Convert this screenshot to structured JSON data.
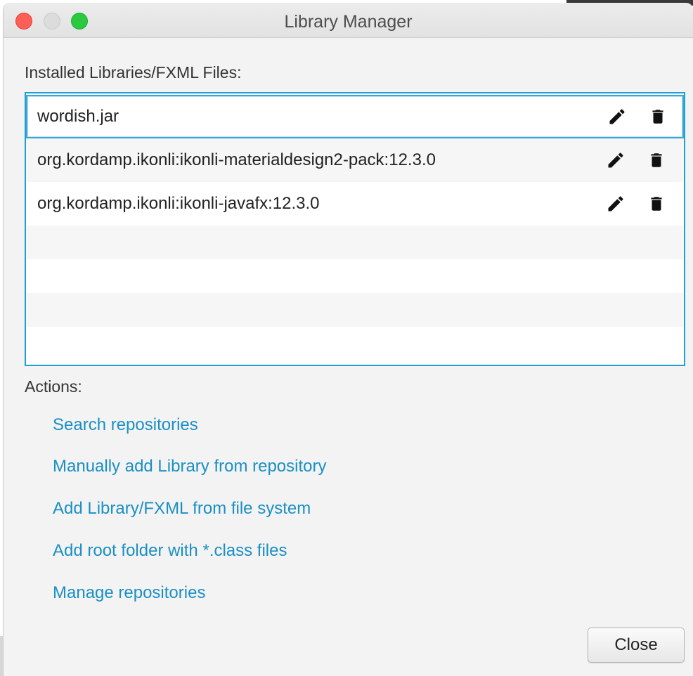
{
  "window": {
    "title": "Library Manager"
  },
  "installed": {
    "label": "Installed Libraries/FXML Files:",
    "items": [
      {
        "name": "wordish.jar",
        "selected": true,
        "edit_icon": "pencil-icon",
        "delete_icon": "trash-icon"
      },
      {
        "name": "org.kordamp.ikonli:ikonli-materialdesign2-pack:12.3.0",
        "selected": false,
        "edit_icon": "pencil-icon",
        "delete_icon": "trash-icon"
      },
      {
        "name": "org.kordamp.ikonli:ikonli-javafx:12.3.0",
        "selected": false,
        "edit_icon": "pencil-icon",
        "delete_icon": "trash-icon"
      }
    ]
  },
  "actions": {
    "label": "Actions:",
    "links": [
      "Search repositories",
      "Manually add Library from repository",
      "Add Library/FXML from file system",
      "Add root folder with *.class files",
      "Manage repositories"
    ]
  },
  "footer": {
    "close_label": "Close"
  },
  "colors": {
    "accent": "#1a8fc4",
    "list_border": "#1ea0d4",
    "traffic_close": "#fd5f57",
    "traffic_max": "#2ac940"
  }
}
